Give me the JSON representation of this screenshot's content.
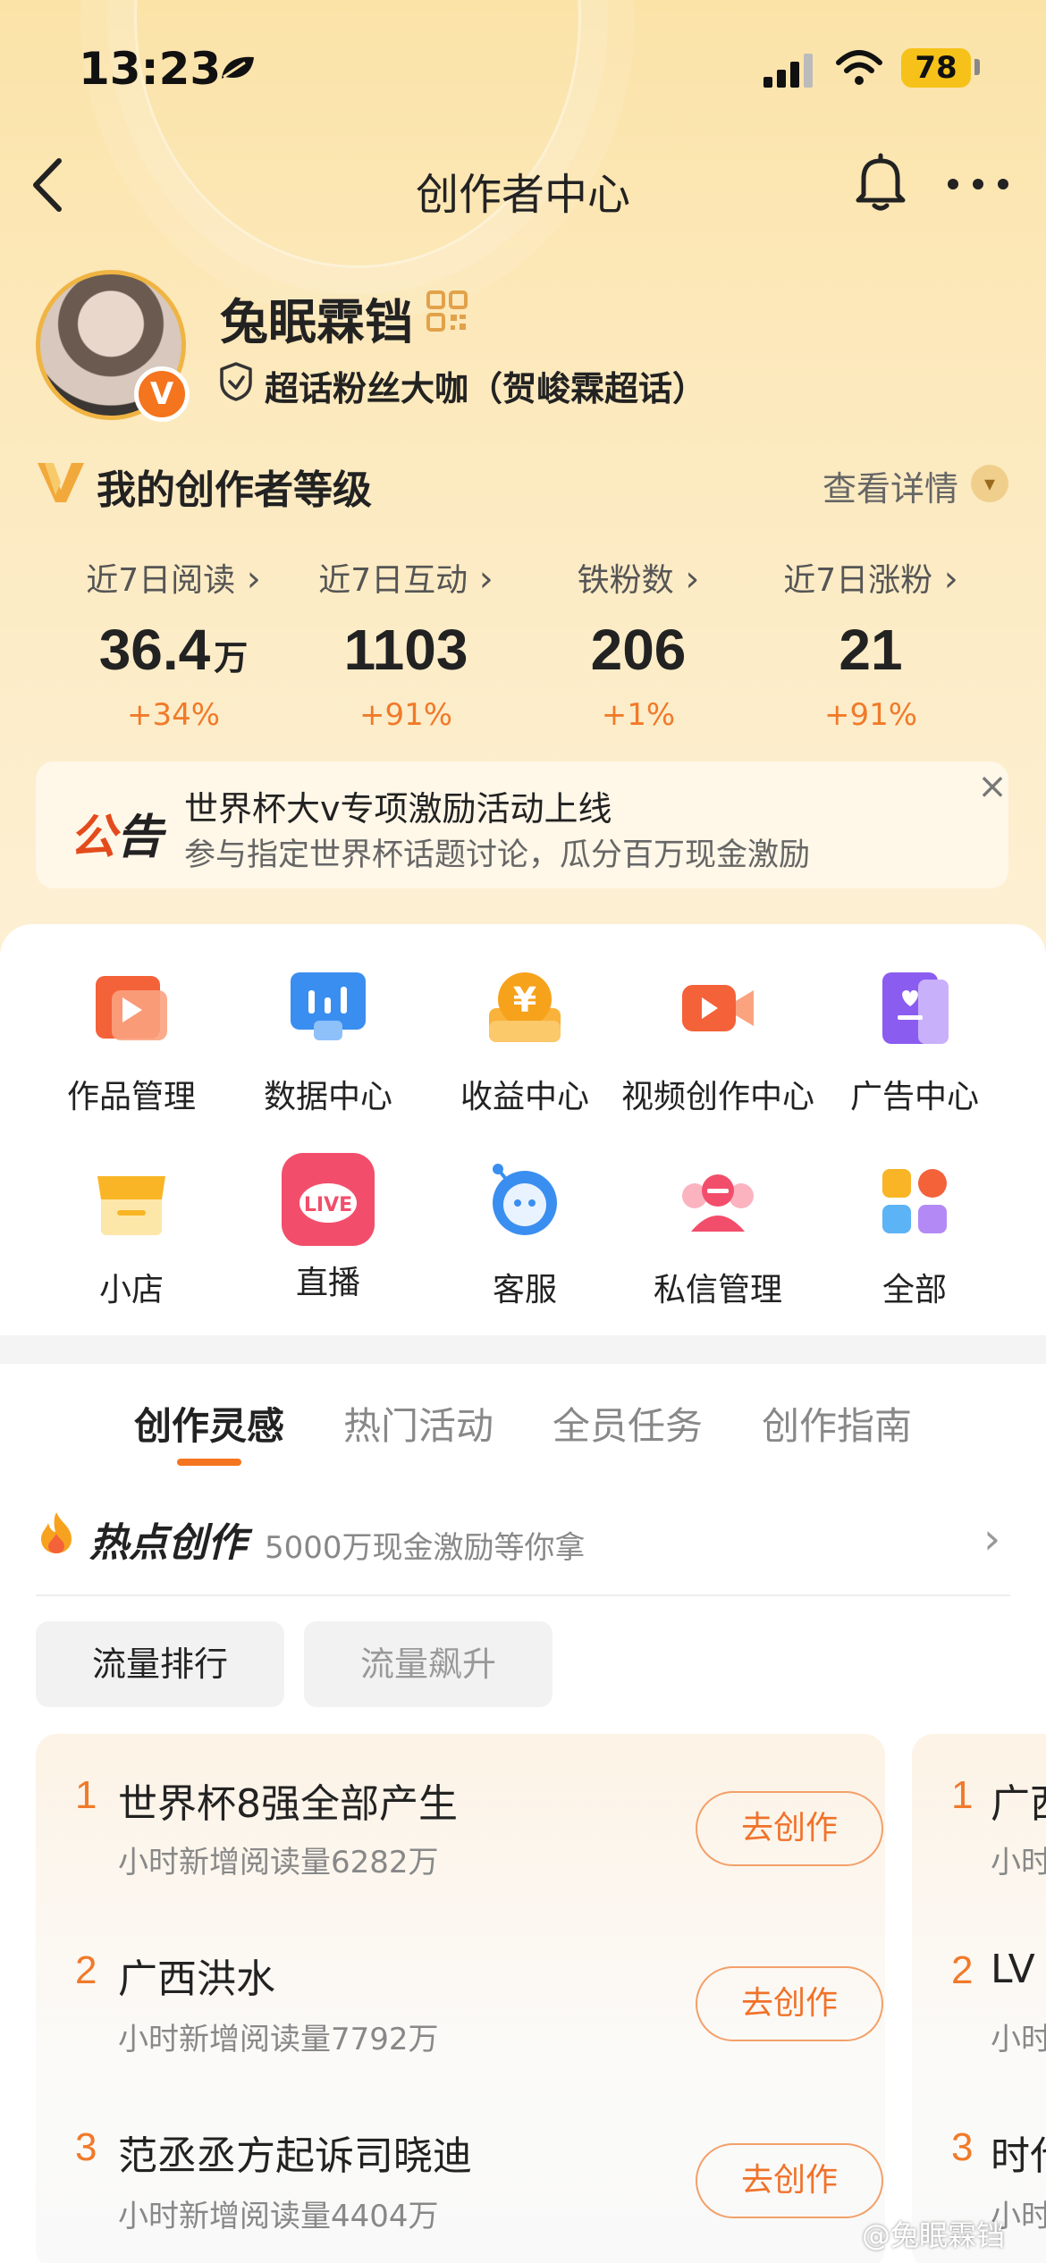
{
  "status_bar": {
    "time": "13:23",
    "battery": "78"
  },
  "nav": {
    "title": "创作者中心"
  },
  "profile": {
    "username": "兔眠霖铛",
    "badge_letter": "V",
    "fan_title": "超话粉丝大咖（贺峻霖超话）"
  },
  "level": {
    "title": "我的创作者等级",
    "detail_label": "查看详情"
  },
  "stats": [
    {
      "label": "近7日阅读",
      "value": "36.4",
      "unit": "万",
      "change": "+34%"
    },
    {
      "label": "近7日互动",
      "value": "1103",
      "unit": "",
      "change": "+91%"
    },
    {
      "label": "铁粉数",
      "value": "206",
      "unit": "",
      "change": "+1%"
    },
    {
      "label": "近7日涨粉",
      "value": "21",
      "unit": "",
      "change": "+91%"
    }
  ],
  "notice": {
    "tag_a": "公",
    "tag_b": "告",
    "title": "世界杯大v专项激励活动上线",
    "subtitle": "参与指定世界杯话题讨论，瓜分百万现金激励",
    "close": "×"
  },
  "tools": [
    {
      "label": "作品管理",
      "icon": "works-icon"
    },
    {
      "label": "数据中心",
      "icon": "data-icon"
    },
    {
      "label": "收益中心",
      "icon": "income-icon"
    },
    {
      "label": "视频创作中心",
      "icon": "video-icon"
    },
    {
      "label": "广告中心",
      "icon": "ad-icon"
    },
    {
      "label": "小店",
      "icon": "shop-icon"
    },
    {
      "label": "直播",
      "icon": "live-icon",
      "icon_text": "LIVE"
    },
    {
      "label": "客服",
      "icon": "service-icon"
    },
    {
      "label": "私信管理",
      "icon": "message-icon"
    },
    {
      "label": "全部",
      "icon": "all-icon"
    }
  ],
  "tabs": [
    "创作灵感",
    "热门活动",
    "全员任务",
    "创作指南"
  ],
  "hot": {
    "title": "热点创作",
    "subtitle": "5000万现金激励等你拿",
    "arrow": "›"
  },
  "chips": [
    "流量排行",
    "流量飙升"
  ],
  "ranking": [
    {
      "rank": "1",
      "title": "世界杯8强全部产生",
      "sub": "小时新增阅读量6282万",
      "button": "去创作"
    },
    {
      "rank": "2",
      "title": "广西洪水",
      "sub": "小时新增阅读量7792万",
      "button": "去创作"
    },
    {
      "rank": "3",
      "title": "范丞丞方起诉司晓迪",
      "sub": "小时新增阅读量4404万",
      "button": "去创作"
    }
  ],
  "ranking_peek": [
    {
      "rank": "1",
      "title": "广西",
      "sub": "小时"
    },
    {
      "rank": "2",
      "title": "LV",
      "sub": "小时"
    },
    {
      "rank": "3",
      "title": "时代",
      "sub": "小时"
    }
  ],
  "watermark": "@兔眠霖铛",
  "colors": {
    "accent": "#f5741e",
    "change": "#f07a2a",
    "notice_red": "#e44b1c"
  }
}
